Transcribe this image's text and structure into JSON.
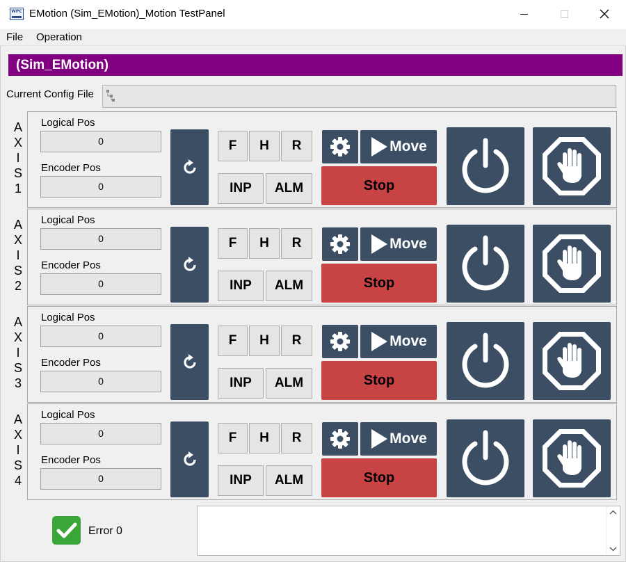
{
  "window": {
    "title": "EMotion (Sim_EMotion)_Motion TestPanel",
    "icon_text": "WPC",
    "icon": "app-logo-icon"
  },
  "menu": [
    {
      "label": "File"
    },
    {
      "label": "Operation"
    }
  ],
  "header": {
    "title": "(Sim_EMotion)",
    "color": "#800080"
  },
  "config": {
    "label": "Current Config File",
    "value": ""
  },
  "axes": [
    {
      "letters": [
        "A",
        "X",
        "I",
        "S",
        "1"
      ],
      "logical_label": "Logical Pos",
      "logical_value": "0",
      "encoder_label": "Encoder Pos",
      "encoder_value": "0"
    },
    {
      "letters": [
        "A",
        "X",
        "I",
        "S",
        "2"
      ],
      "logical_label": "Logical Pos",
      "logical_value": "0",
      "encoder_label": "Encoder Pos",
      "encoder_value": "0"
    },
    {
      "letters": [
        "A",
        "X",
        "I",
        "S",
        "3"
      ],
      "logical_label": "Logical Pos",
      "logical_value": "0",
      "encoder_label": "Encoder Pos",
      "encoder_value": "0"
    },
    {
      "letters": [
        "A",
        "X",
        "I",
        "S",
        "4"
      ],
      "logical_label": "Logical Pos",
      "logical_value": "0",
      "encoder_label": "Encoder Pos",
      "encoder_value": "0"
    }
  ],
  "buttons": {
    "f": "F",
    "h": "H",
    "r": "R",
    "inp": "INP",
    "alm": "ALM",
    "move": "Move",
    "stop": "Stop"
  },
  "icons": {
    "reset": "refresh-icon",
    "settings": "gear-icon",
    "move": "play-icon",
    "servo": "power-icon",
    "emg": "stop-hand-icon"
  },
  "status": {
    "text": "Error 0",
    "icon": "check-icon",
    "color": "#3aa63a"
  },
  "log": {
    "text": ""
  },
  "colors": {
    "dark_button": "#3c4e63",
    "stop_button": "#c84444"
  }
}
